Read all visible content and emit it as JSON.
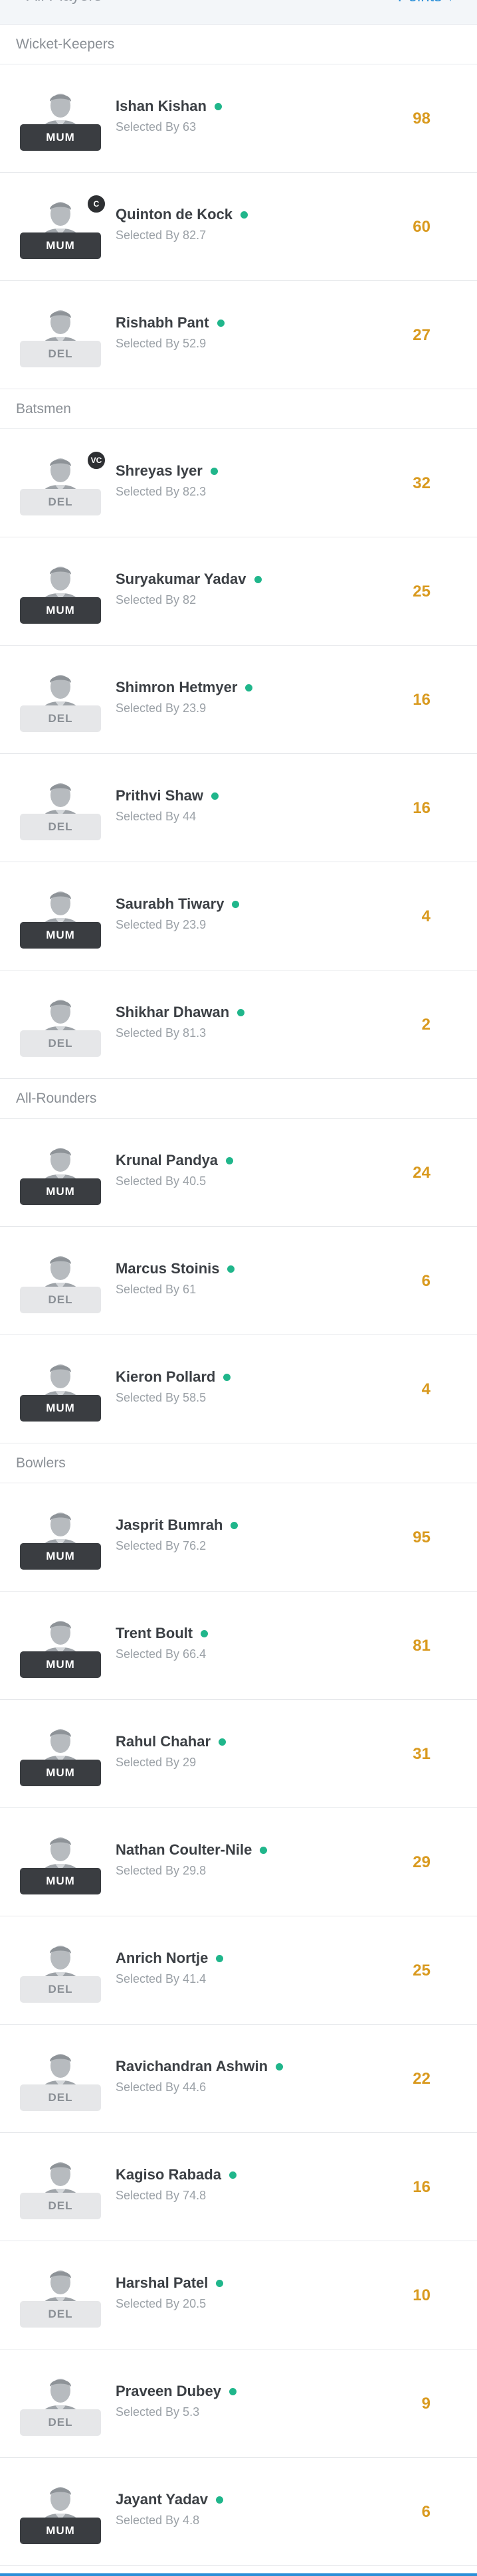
{
  "top": {
    "left_label": "All Players",
    "right_label": "Points ▾"
  },
  "sections": [
    {
      "title": "Wicket-Keepers",
      "players": [
        {
          "name": "Ishan Kishan",
          "selected": "Selected By 63",
          "team": "MUM",
          "points": "98",
          "role": ""
        },
        {
          "name": "Quinton de Kock",
          "selected": "Selected By 82.7",
          "team": "MUM",
          "points": "60",
          "role": "C"
        },
        {
          "name": "Rishabh Pant",
          "selected": "Selected By 52.9",
          "team": "DEL",
          "points": "27",
          "role": ""
        }
      ]
    },
    {
      "title": "Batsmen",
      "players": [
        {
          "name": "Shreyas Iyer",
          "selected": "Selected By 82.3",
          "team": "DEL",
          "points": "32",
          "role": "VC"
        },
        {
          "name": "Suryakumar Yadav",
          "selected": "Selected By 82",
          "team": "MUM",
          "points": "25",
          "role": ""
        },
        {
          "name": "Shimron Hetmyer",
          "selected": "Selected By 23.9",
          "team": "DEL",
          "points": "16",
          "role": ""
        },
        {
          "name": "Prithvi Shaw",
          "selected": "Selected By 44",
          "team": "DEL",
          "points": "16",
          "role": ""
        },
        {
          "name": "Saurabh Tiwary",
          "selected": "Selected By 23.9",
          "team": "MUM",
          "points": "4",
          "role": ""
        },
        {
          "name": "Shikhar Dhawan",
          "selected": "Selected By 81.3",
          "team": "DEL",
          "points": "2",
          "role": ""
        }
      ]
    },
    {
      "title": "All-Rounders",
      "players": [
        {
          "name": "Krunal Pandya",
          "selected": "Selected By 40.5",
          "team": "MUM",
          "points": "24",
          "role": ""
        },
        {
          "name": "Marcus Stoinis",
          "selected": "Selected By 61",
          "team": "DEL",
          "points": "6",
          "role": ""
        },
        {
          "name": "Kieron Pollard",
          "selected": "Selected By 58.5",
          "team": "MUM",
          "points": "4",
          "role": ""
        }
      ]
    },
    {
      "title": "Bowlers",
      "players": [
        {
          "name": "Jasprit Bumrah",
          "selected": "Selected By 76.2",
          "team": "MUM",
          "points": "95",
          "role": ""
        },
        {
          "name": "Trent Boult",
          "selected": "Selected By 66.4",
          "team": "MUM",
          "points": "81",
          "role": ""
        },
        {
          "name": "Rahul Chahar",
          "selected": "Selected By 29",
          "team": "MUM",
          "points": "31",
          "role": ""
        },
        {
          "name": "Nathan Coulter-Nile",
          "selected": "Selected By 29.8",
          "team": "MUM",
          "points": "29",
          "role": ""
        },
        {
          "name": "Anrich Nortje",
          "selected": "Selected By 41.4",
          "team": "DEL",
          "points": "25",
          "role": ""
        },
        {
          "name": "Ravichandran Ashwin",
          "selected": "Selected By 44.6",
          "team": "DEL",
          "points": "22",
          "role": ""
        },
        {
          "name": "Kagiso Rabada",
          "selected": "Selected By 74.8",
          "team": "DEL",
          "points": "16",
          "role": ""
        },
        {
          "name": "Harshal Patel",
          "selected": "Selected By 20.5",
          "team": "DEL",
          "points": "10",
          "role": ""
        },
        {
          "name": "Praveen Dubey",
          "selected": "Selected By 5.3",
          "team": "DEL",
          "points": "9",
          "role": ""
        },
        {
          "name": "Jayant Yadav",
          "selected": "Selected By 4.8",
          "team": "MUM",
          "points": "6",
          "role": ""
        }
      ]
    }
  ],
  "colors": {
    "points": "#d99a1f",
    "status_dot": "#20b68b",
    "team_dark": "#3a3d41",
    "team_light": "#e6e7e9",
    "accent": "#2a8fd8"
  },
  "icons": {
    "avatar": "player-silhouette-icon",
    "status": "playing-status-dot-icon"
  }
}
